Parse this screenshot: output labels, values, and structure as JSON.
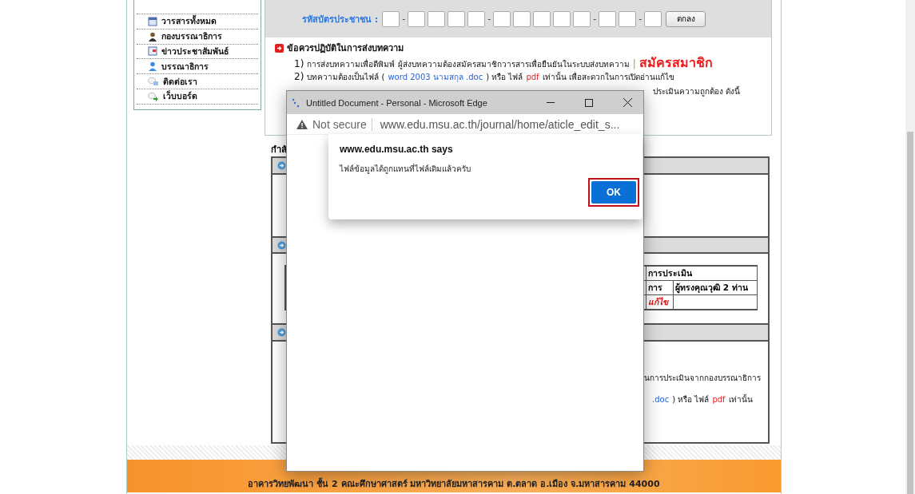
{
  "sidebar": {
    "items": [
      {
        "label": "วารสารทั้งหมด"
      },
      {
        "label": "กองบรรณาธิการ"
      },
      {
        "label": "ข่าวประชาสัมพันธ์"
      },
      {
        "label": "บรรณาธิการ"
      },
      {
        "label": "ติดต่อเรา"
      },
      {
        "label": "เว็บบอร์ด"
      }
    ]
  },
  "id_form": {
    "label": "รหัสบัตรประชาชน :",
    "separator": "-",
    "button": "ตกลง"
  },
  "instructions": {
    "title": "ข้อควรปฏิบัติในการส่งบทความ",
    "lines": [
      {
        "number": "1)",
        "segments": [
          {
            "text": "การส่งบทความเพื่อตีพิมพ์ ผู้ส่งบทความต้องสมัครสมาชิกวารสารเพื่อยืนยันในระบบส่งบทความ"
          },
          {
            "kind": "separator",
            "text": "|"
          },
          {
            "color": "#f01818",
            "kind": "link",
            "text": "สมัครสมาชิก"
          }
        ]
      },
      {
        "number": "2)",
        "segments": [
          {
            "text": "บทความต้องเป็นไฟล์ ("
          },
          {
            "color": "#2a63d6",
            "text": "word 2003 นามสกุล .doc"
          },
          {
            "text": ") หรือ ไฟล์"
          },
          {
            "color": "#f02020",
            "text": "pdf"
          },
          {
            "text": "เท่านั้น เพื่อสะดวกในการเปิดอ่านแก้ไข"
          }
        ]
      },
      {
        "segments": [
          {
            "text": "ประเมินความถูกต้อง ดังนี้"
          }
        ]
      }
    ]
  },
  "status_label": "กำลั",
  "sections": [
    {
      "kind": "blank"
    },
    {
      "kind": "evaluation",
      "table": {
        "heading": "การประเมิน",
        "columns": [
          "การ",
          "ผู้ทรงคุณวุฒิ 2 ท่าน"
        ],
        "row": [
          "แก้ไข"
        ]
      }
    },
    {
      "kind": "text",
      "lines": [
        [
          {
            "text": "นการประเมินจากกองบรรณาธิการ"
          }
        ],
        [
          {
            "color": "#2a63d6",
            "text": ".doc"
          },
          {
            "text": ") หรือ ไฟล์"
          },
          {
            "color": "#f02020",
            "text": "pdf"
          },
          {
            "text": "เท่านั้น"
          }
        ]
      ]
    }
  ],
  "footer": {
    "address": "อาคารวิทยพัฒนา ชั้น 2 คณะศึกษาศาสตร์ มหาวิทยาลัยมหาสารคาม ต.ตลาด อ.เมือง จ.มหาสารคาม 44000"
  },
  "browser_window": {
    "title": "Untitled Document - Personal - Microsoft Edge",
    "security": "Not secure",
    "url": "www.edu.msu.ac.th/journal/home/aticle_edit_s...",
    "alert": {
      "origin": "www.edu.msu.ac.th says",
      "message": "ไฟล์ข้อมูลได้ถูกแทนที่ไฟล์เดิมแล้วครับ",
      "button": "OK",
      "highlighted": true
    }
  }
}
